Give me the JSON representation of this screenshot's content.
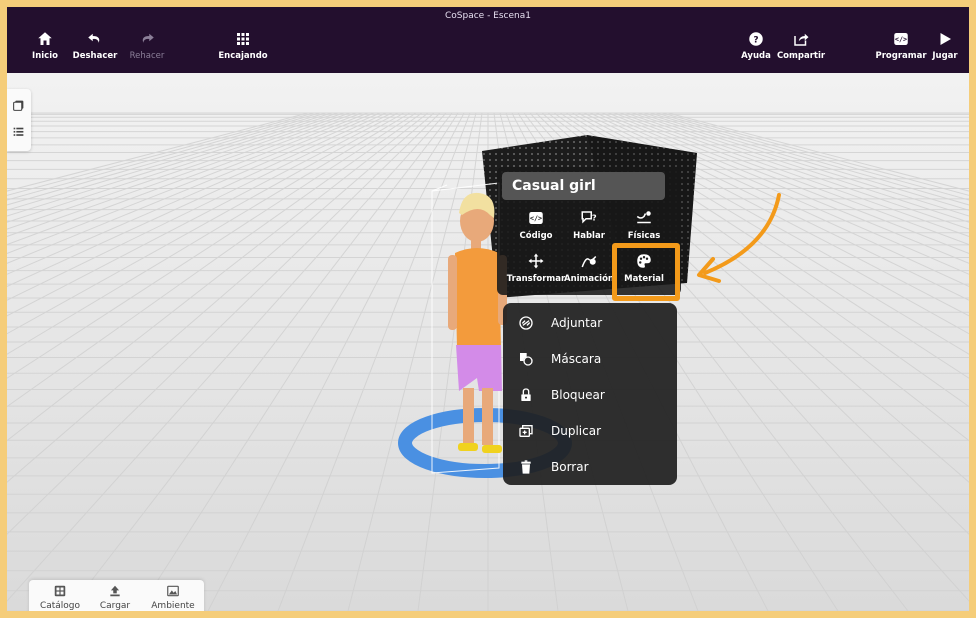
{
  "app_title": "CoSpace - Escena1",
  "toolbar": {
    "home": "Inicio",
    "undo": "Deshacer",
    "redo": "Rehacer",
    "snap": "Encajando",
    "help": "Ayuda",
    "share": "Compartir",
    "code": "Programar",
    "play": "Jugar"
  },
  "bottom_bar": {
    "catalog": "Catálogo",
    "upload": "Cargar",
    "environment": "Ambiente"
  },
  "object_panel": {
    "name": "Casual girl",
    "tools": {
      "code": "Código",
      "speak": "Hablar",
      "physics": "Físicas",
      "transform": "Transformar",
      "animation": "Animación",
      "material": "Material"
    }
  },
  "context_menu": {
    "attach": "Adjuntar",
    "mask": "Máscara",
    "lock": "Bloquear",
    "duplicate": "Duplicar",
    "delete": "Borrar"
  },
  "colors": {
    "toolbar_bg": "#230f2e",
    "highlight": "#f39a1a",
    "selection_ring": "#4a90e2"
  }
}
